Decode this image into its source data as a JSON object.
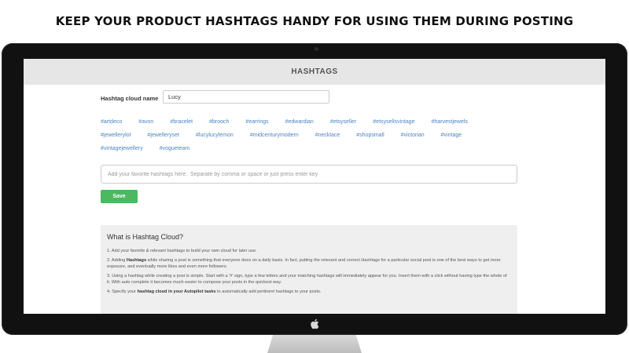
{
  "headline": "KEEP YOUR PRODUCT HASHTAGS HANDY FOR USING THEM DURING POSTING",
  "app": {
    "title": "HASHTAGS",
    "cloud_name_label": "Hashtag cloud name",
    "cloud_name_value": "Lucy",
    "hashtags": [
      "#artdeco",
      "#avon",
      "#bracelet",
      "#brooch",
      "#earrings",
      "#edwardian",
      "#etsyseller",
      "#etsysellsvintage",
      "#harvestjewels",
      "#jewellerylot",
      "#jewelleryset",
      "#lucylucylemon",
      "#midcenturymodern",
      "#necklace",
      "#shopsmall",
      "#victorian",
      "#vintage",
      "#vintagejewellery",
      "#vogueteam"
    ],
    "hashtag_input_placeholder": "Add your favorite hashtags here.  Separate by comma or space or just press enter key",
    "save_label": "Save",
    "info": {
      "title": "What is Hashtag Cloud?",
      "item1": "1. Add your favorite & relevant hashtags to build your own cloud for later use.",
      "item2_a": "2. Adding ",
      "item2_b": "Hashtags",
      "item2_c": " while sharing a post is something that everyone does on a daily basis. In fact, putting the relevant and correct Hashtags for a particular social post is one of the best ways to get more exposure, and eventually more likes and even more followers.",
      "item3": "3. Using a hashtag while creating a post is simple. Start with a '#' sign, type a few letters and your matching hashtags will immediately appear for you. Insert them with a click without having type the whole of it. With auto complete it becomes much easier to compose your posts in the quickest way.",
      "item4_a": "4. Specify your ",
      "item4_b": "hashtag cloud in your Autopilot tasks",
      "item4_c": " to automatically add pertinent hashtags to your posts."
    }
  }
}
